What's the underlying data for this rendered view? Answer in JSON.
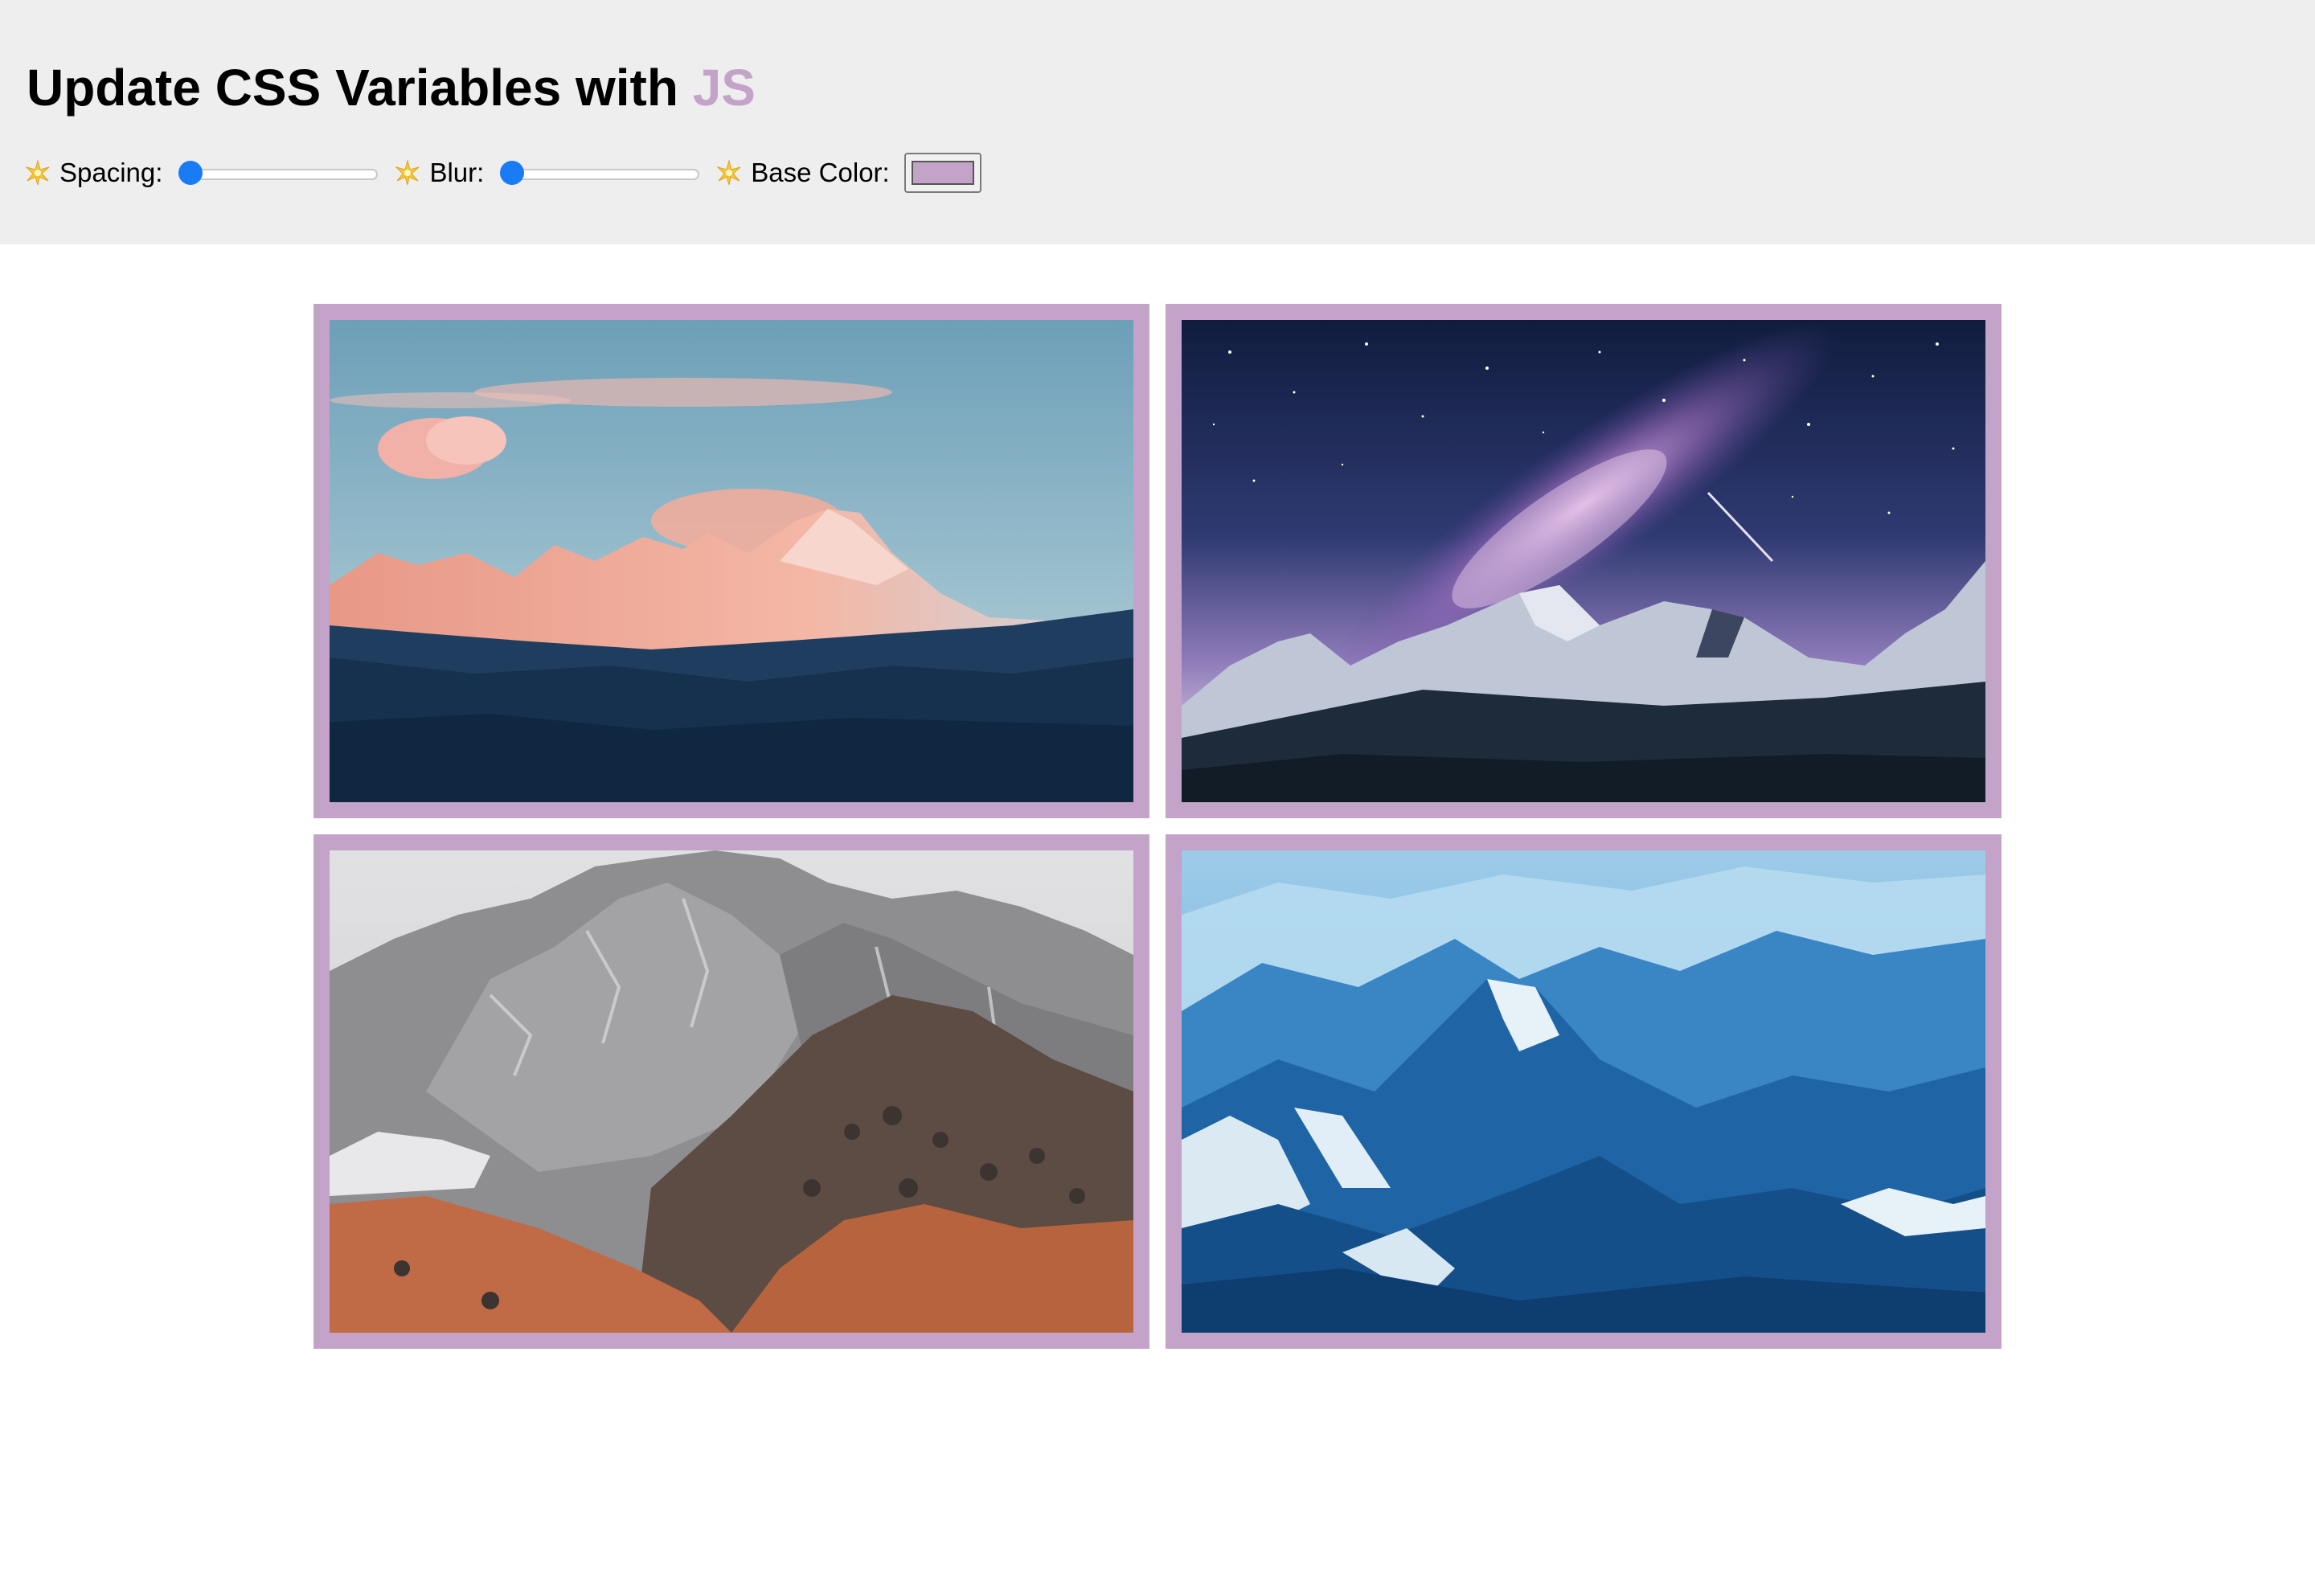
{
  "header": {
    "title_main": "Update CSS Variables with",
    "title_highlight": "JS"
  },
  "controls": [
    {
      "label": "Spacing:",
      "type": "range",
      "value_fraction": 0.0,
      "icon": "sparkle-icon"
    },
    {
      "label": "Blur:",
      "type": "range",
      "value_fraction": 0.0,
      "icon": "sparkle-icon"
    },
    {
      "label": "Base Color:",
      "type": "color",
      "value": "#c3a3c8",
      "icon": "sparkle-icon"
    }
  ],
  "colors": {
    "base": "#c3a3c8",
    "header_bg": "#eeeeee",
    "slider_thumb": "#1a7cf5"
  },
  "gallery": {
    "images": [
      {
        "subject": "pink-lit snowy mountain range at dawn"
      },
      {
        "subject": "milky way night sky over snowy peaks"
      },
      {
        "subject": "rocky grey mountain with orange autumn trees"
      },
      {
        "subject": "aerial view of blue snowy mountains"
      }
    ]
  }
}
